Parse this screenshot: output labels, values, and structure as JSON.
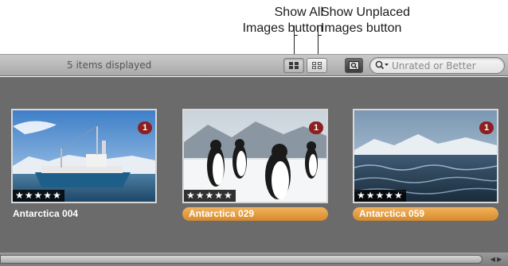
{
  "callouts": {
    "show_all": {
      "line1": "Show All",
      "line2": "Images button"
    },
    "show_unplaced": {
      "line1": "Show Unplaced",
      "line2": "Images button"
    }
  },
  "toolbar": {
    "items_displayed": "5 items displayed",
    "search_placeholder": "Unrated or Better"
  },
  "items": [
    {
      "name": "Antarctica 004",
      "badge": "1",
      "stars": "★★★★★",
      "selected": false
    },
    {
      "name": "Antarctica 029",
      "badge": "1",
      "stars": "★★★★★",
      "selected": true
    },
    {
      "name": "Antarctica 059",
      "badge": "1",
      "stars": "★★★★★",
      "selected": true
    }
  ]
}
